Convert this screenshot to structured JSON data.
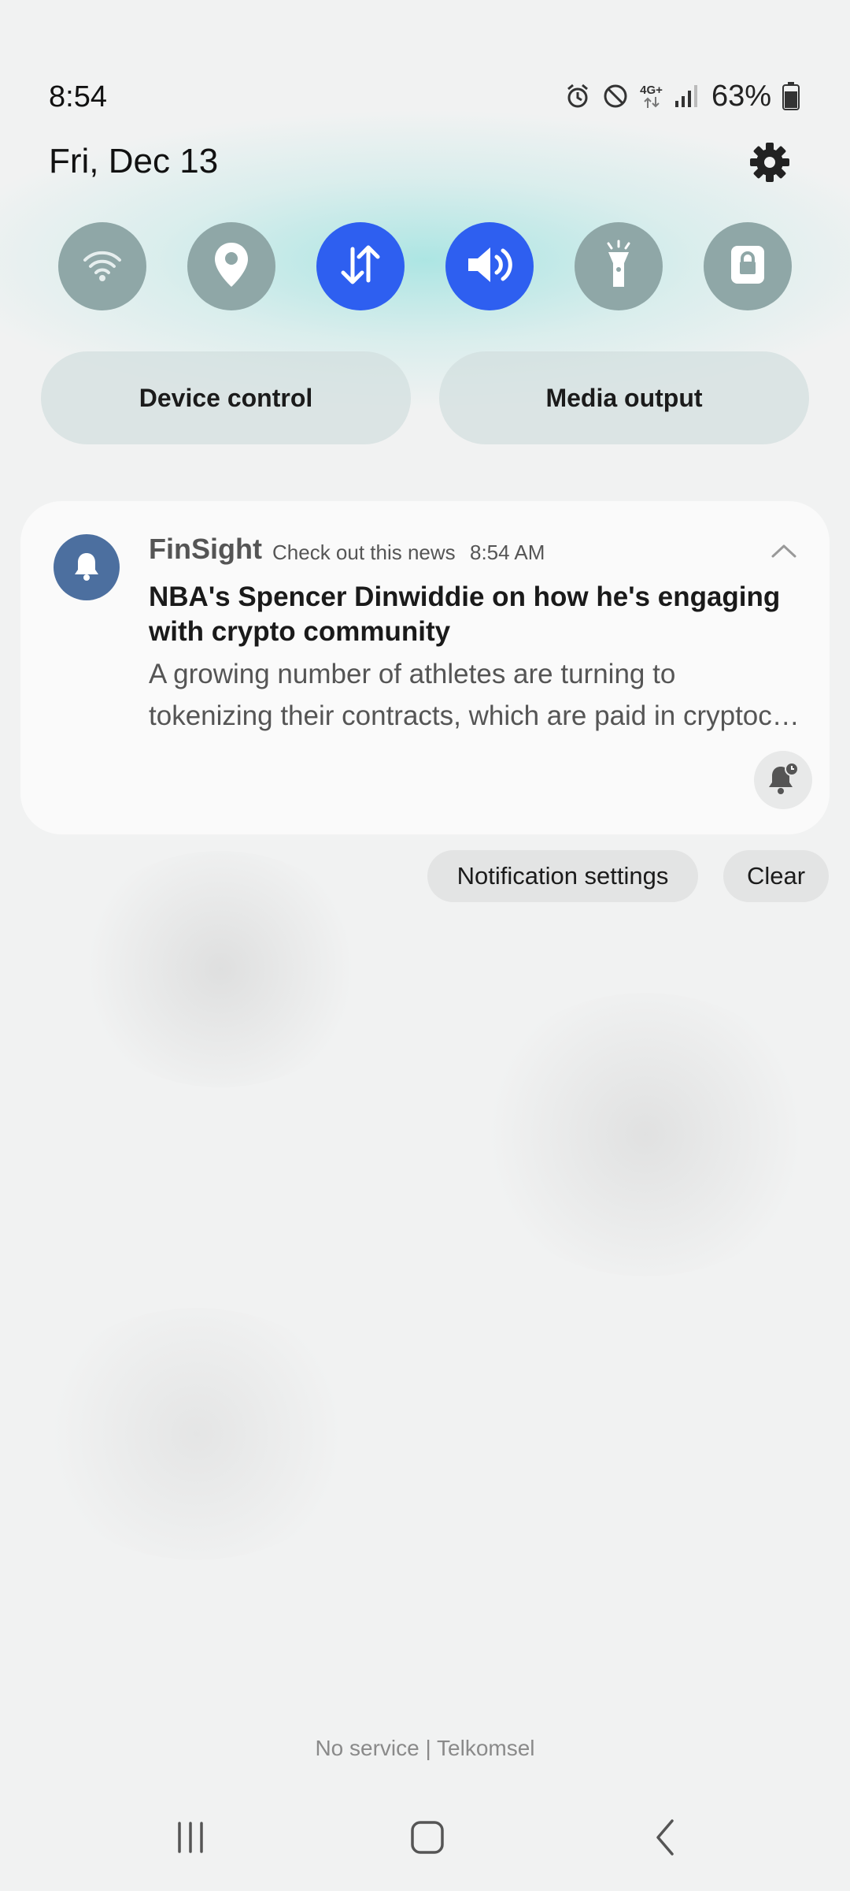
{
  "status_bar": {
    "time": "8:54",
    "network_label": "4G+",
    "battery_percent": "63%",
    "icons": [
      "alarm-icon",
      "do-not-disturb-icon",
      "network-4g-icon",
      "signal-icon",
      "battery-icon"
    ]
  },
  "header": {
    "date": "Fri, Dec 13",
    "settings_icon": "gear-icon"
  },
  "quick_toggles": [
    {
      "name": "wifi",
      "icon": "wifi-icon",
      "active": false
    },
    {
      "name": "location",
      "icon": "location-icon",
      "active": false
    },
    {
      "name": "mobile-data",
      "icon": "data-arrows-icon",
      "active": true
    },
    {
      "name": "sound",
      "icon": "speaker-icon",
      "active": true
    },
    {
      "name": "flashlight",
      "icon": "flashlight-icon",
      "active": false
    },
    {
      "name": "secure-folder",
      "icon": "lock-icon",
      "active": false
    }
  ],
  "pills": {
    "device_control": "Device control",
    "media_output": "Media output"
  },
  "notification": {
    "app_name": "FinSight",
    "subtext": "Check out this news",
    "time": "8:54 AM",
    "title": "NBA's Spencer Dinwiddie on how he's engaging with crypto community",
    "body_line1": "A growing number of athletes are turning to",
    "body_line2": "tokenizing their contracts, which are paid in cryptocurrency",
    "accent_color": "#4c6f9f"
  },
  "actions": {
    "notification_settings": "Notification settings",
    "clear": "Clear"
  },
  "carrier": "No service | Telkomsel",
  "colors": {
    "toggle_on": "#2e5ff0",
    "toggle_off": "#8fa7a7"
  }
}
